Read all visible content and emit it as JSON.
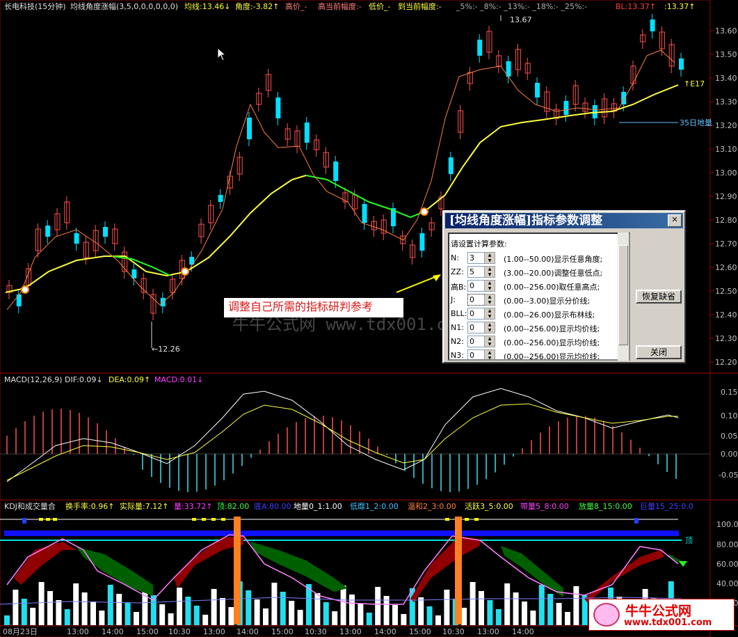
{
  "main_title": {
    "stock": "长电科技(15分钟)",
    "indicator": "均线角度涨幅(3,5,0,0,0,0,0,0)",
    "ma_line": "均线:13.46↓",
    "angle": "角度:-3.82↑",
    "high_price": "高价_-",
    "high_amp": "高当前幅度:-",
    "low_price": "低价_-",
    "to_low_amp": "到当前幅度:-",
    "pcts": "_5%:-  _8%:-  _13%:-  _18%:-  _25%:-",
    "bl": "BL:13.37↑",
    "bl2": ":13.37↑"
  },
  "price_axis": [
    "13.60",
    "13.50",
    "13.40",
    "13.30",
    "13.20",
    "13.10",
    "13.00",
    "12.90",
    "12.80",
    "12.70",
    "12.60",
    "12.50",
    "12.40",
    "12.30",
    "12.20"
  ],
  "price_notes": {
    "high": "13.67",
    "low": "←12.26",
    "e17": "↑E17",
    "ma35": "35日地量"
  },
  "macd_title": {
    "name": "MACD(12,26,9)",
    "dif": "DIF:0.09↓",
    "dea": "DEA:0.09↑",
    "macd": "MACD:0.01↓"
  },
  "macd_axis": [
    "0.15",
    "0.10",
    "0.05",
    "0.00",
    "-0.05"
  ],
  "kdj_title": {
    "name": "KDJ和成交量合",
    "turnover": "换手率:0.96↑",
    "actual": "实际量:7.12↑",
    "vol": "量:33.72↑",
    "top": "顶:82.00",
    "bottom": "底A:80.00",
    "ground": "地量0_1:1.00",
    "low": "低靡1_2:0.00",
    "mild": "温和2_3:0.00",
    "active": "活跃3_5:0.00",
    "band": "带量5_8:0.00",
    "release": "放量8_15:0.00",
    "huge": "巨量15_25:0.0"
  },
  "kdj_axis": [
    "100.0",
    "80.00",
    "60.00",
    "40.00",
    "20.00"
  ],
  "kdj_top_label": "顶",
  "time_axis": [
    "08月23日",
    "13:00",
    "14:00",
    "15:00",
    "10:30",
    "13:00",
    "14:00",
    "15:00",
    "10:30",
    "13:00",
    "14:00",
    "15:00",
    "10:30",
    "13:00",
    "14:00"
  ],
  "annotation": "调整自己所需的指标研判参考",
  "watermark": "牛牛公式网 www.tdx001.com",
  "dialog": {
    "title": "[均线角度涨幅]指标参数调整",
    "prompt": "请设置计算参数:",
    "params": [
      {
        "label": "N:",
        "value": "3",
        "desc": "(1.00--50.00)显示任意角度;"
      },
      {
        "label": "ZZ:",
        "value": "5",
        "desc": "(3.00--20.00)调整任意低点;"
      },
      {
        "label": "高B:",
        "value": "0",
        "desc": "(0.00--256.00)取任意高点;"
      },
      {
        "label": "J:",
        "value": "0",
        "desc": "(0.00--3.00)显示分价线;"
      },
      {
        "label": "BLL:",
        "value": "0",
        "desc": "(0.00--26.00)显示布林线;"
      },
      {
        "label": "N1:",
        "value": "0",
        "desc": "(0.00--256.00)显示均价线;"
      },
      {
        "label": "N2:",
        "value": "0",
        "desc": "(0.00--256.00)显示均价线;"
      },
      {
        "label": "N3:",
        "value": "0",
        "desc": "(0.00--256.00)显示均价线;"
      }
    ],
    "restore_btn": "恢复缺省",
    "close_btn": "关闭",
    "close_x": "✕"
  },
  "logo": {
    "title": "牛牛公式网",
    "url": "www.tdx001.com"
  },
  "colors": {
    "up": "#ff5050",
    "down": "#00e0ff",
    "ma_yellow": "#ffff40",
    "ma_green": "#20ff20",
    "grid": "#800000"
  }
}
